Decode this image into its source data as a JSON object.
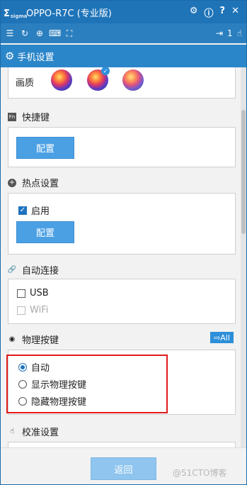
{
  "titlebar": {
    "logo": "Σ",
    "logo_sub": "sigma",
    "title": "OPPO-R7C (专业版)",
    "icons": [
      "gear-icon",
      "info-icon",
      "help-icon",
      "close-icon"
    ]
  },
  "toolbar": {
    "page_indicator": "1",
    "icons": [
      "list-icon",
      "refresh-icon",
      "zoom-icon",
      "keyboard-icon",
      "fullscreen-icon",
      "export-icon",
      "touch-icon"
    ]
  },
  "tab": {
    "label": "手机设置"
  },
  "sections": {
    "quality": {
      "label": "画质",
      "selected_index": 1
    },
    "shortcut": {
      "label": "快捷键",
      "button": "配置"
    },
    "hotspot": {
      "label": "热点设置",
      "enable_label": "启用",
      "enabled": true,
      "button": "配置"
    },
    "autoconnect": {
      "label": "自动连接",
      "usb_label": "USB",
      "wifi_label": "WiFi"
    },
    "physical_keys": {
      "label": "物理按键",
      "all_label": "All",
      "options": [
        "自动",
        "显示物理按键",
        "隐藏物理按键"
      ],
      "selected": 0
    },
    "calibration": {
      "label": "校准设置"
    }
  },
  "footer": {
    "back_label": "返回",
    "watermark": "@51CTO博客"
  },
  "colors": {
    "accent": "#1f74b8",
    "button": "#4ba0e4",
    "highlight_box": "#e21b1b"
  }
}
